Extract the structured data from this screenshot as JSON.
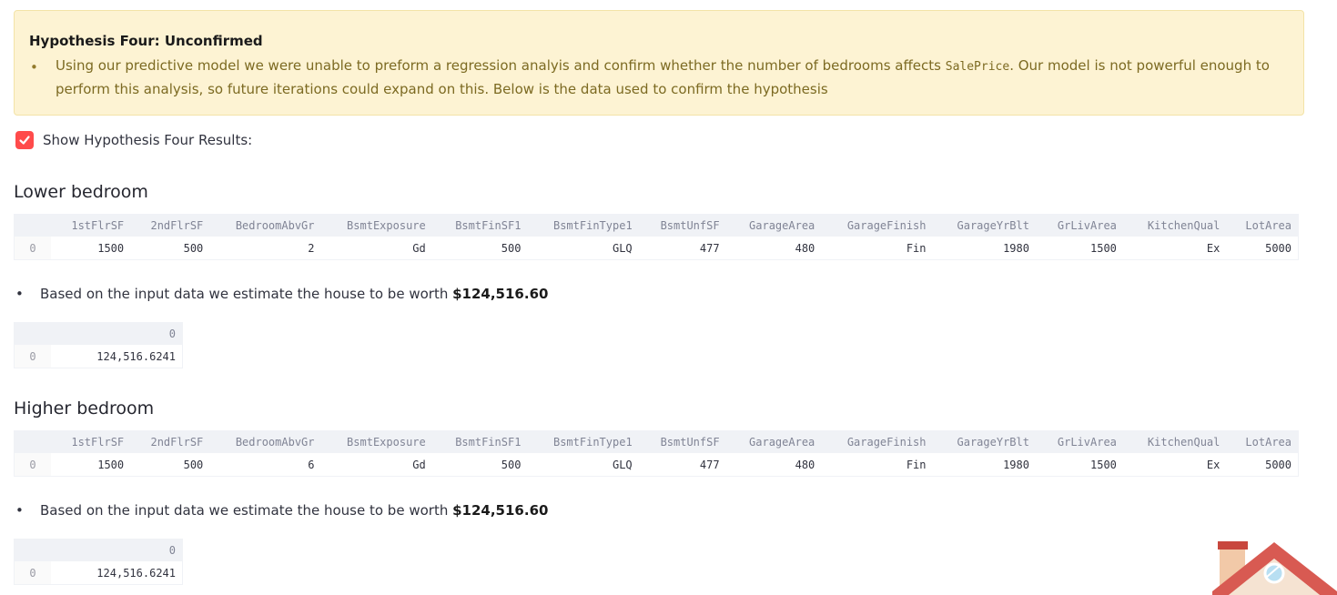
{
  "alert": {
    "title": "Hypothesis Four: Unconfirmed",
    "text_before_code": "Using our predictive model we were unable to preform a regression analyis and confirm whether the number of bedrooms affects ",
    "code": "SalePrice",
    "text_after_code": ". Our model is not powerful enough to perform this analysis, so future iterations could expand on this. Below is the data used to confirm the hypothesis",
    "bullet": "•"
  },
  "checkbox": {
    "label": "Show Hypothesis Four Results:",
    "checked": true,
    "color": "#ff4b4b"
  },
  "columns": [
    "1stFlrSF",
    "2ndFlrSF",
    "BedroomAbvGr",
    "BsmtExposure",
    "BsmtFinSF1",
    "BsmtFinType1",
    "BsmtUnfSF",
    "GarageArea",
    "GarageFinish",
    "GarageYrBlt",
    "GrLivArea",
    "KitchenQual",
    "LotArea"
  ],
  "sections": [
    {
      "title": "Lower bedroom",
      "row_index": "0",
      "row": [
        "1500",
        "500",
        "2",
        "Gd",
        "500",
        "GLQ",
        "477",
        "480",
        "Fin",
        "1980",
        "1500",
        "Ex",
        "5000"
      ],
      "estimate_prefix": "Based on the input data we estimate the house to be worth ",
      "estimate_value": "$124,516.60",
      "pred_header": "0",
      "pred_index": "0",
      "pred_value": "124,516.6241"
    },
    {
      "title": "Higher bedroom",
      "row_index": "0",
      "row": [
        "1500",
        "500",
        "6",
        "Gd",
        "500",
        "GLQ",
        "477",
        "480",
        "Fin",
        "1980",
        "1500",
        "Ex",
        "5000"
      ],
      "estimate_prefix": "Based on the input data we estimate the house to be worth ",
      "estimate_value": "$124,516.60",
      "pred_header": "0",
      "pred_index": "0",
      "pred_value": "124,516.6241"
    }
  ],
  "icons": {
    "checkmark": "checkmark-icon",
    "house": "house-icon"
  }
}
